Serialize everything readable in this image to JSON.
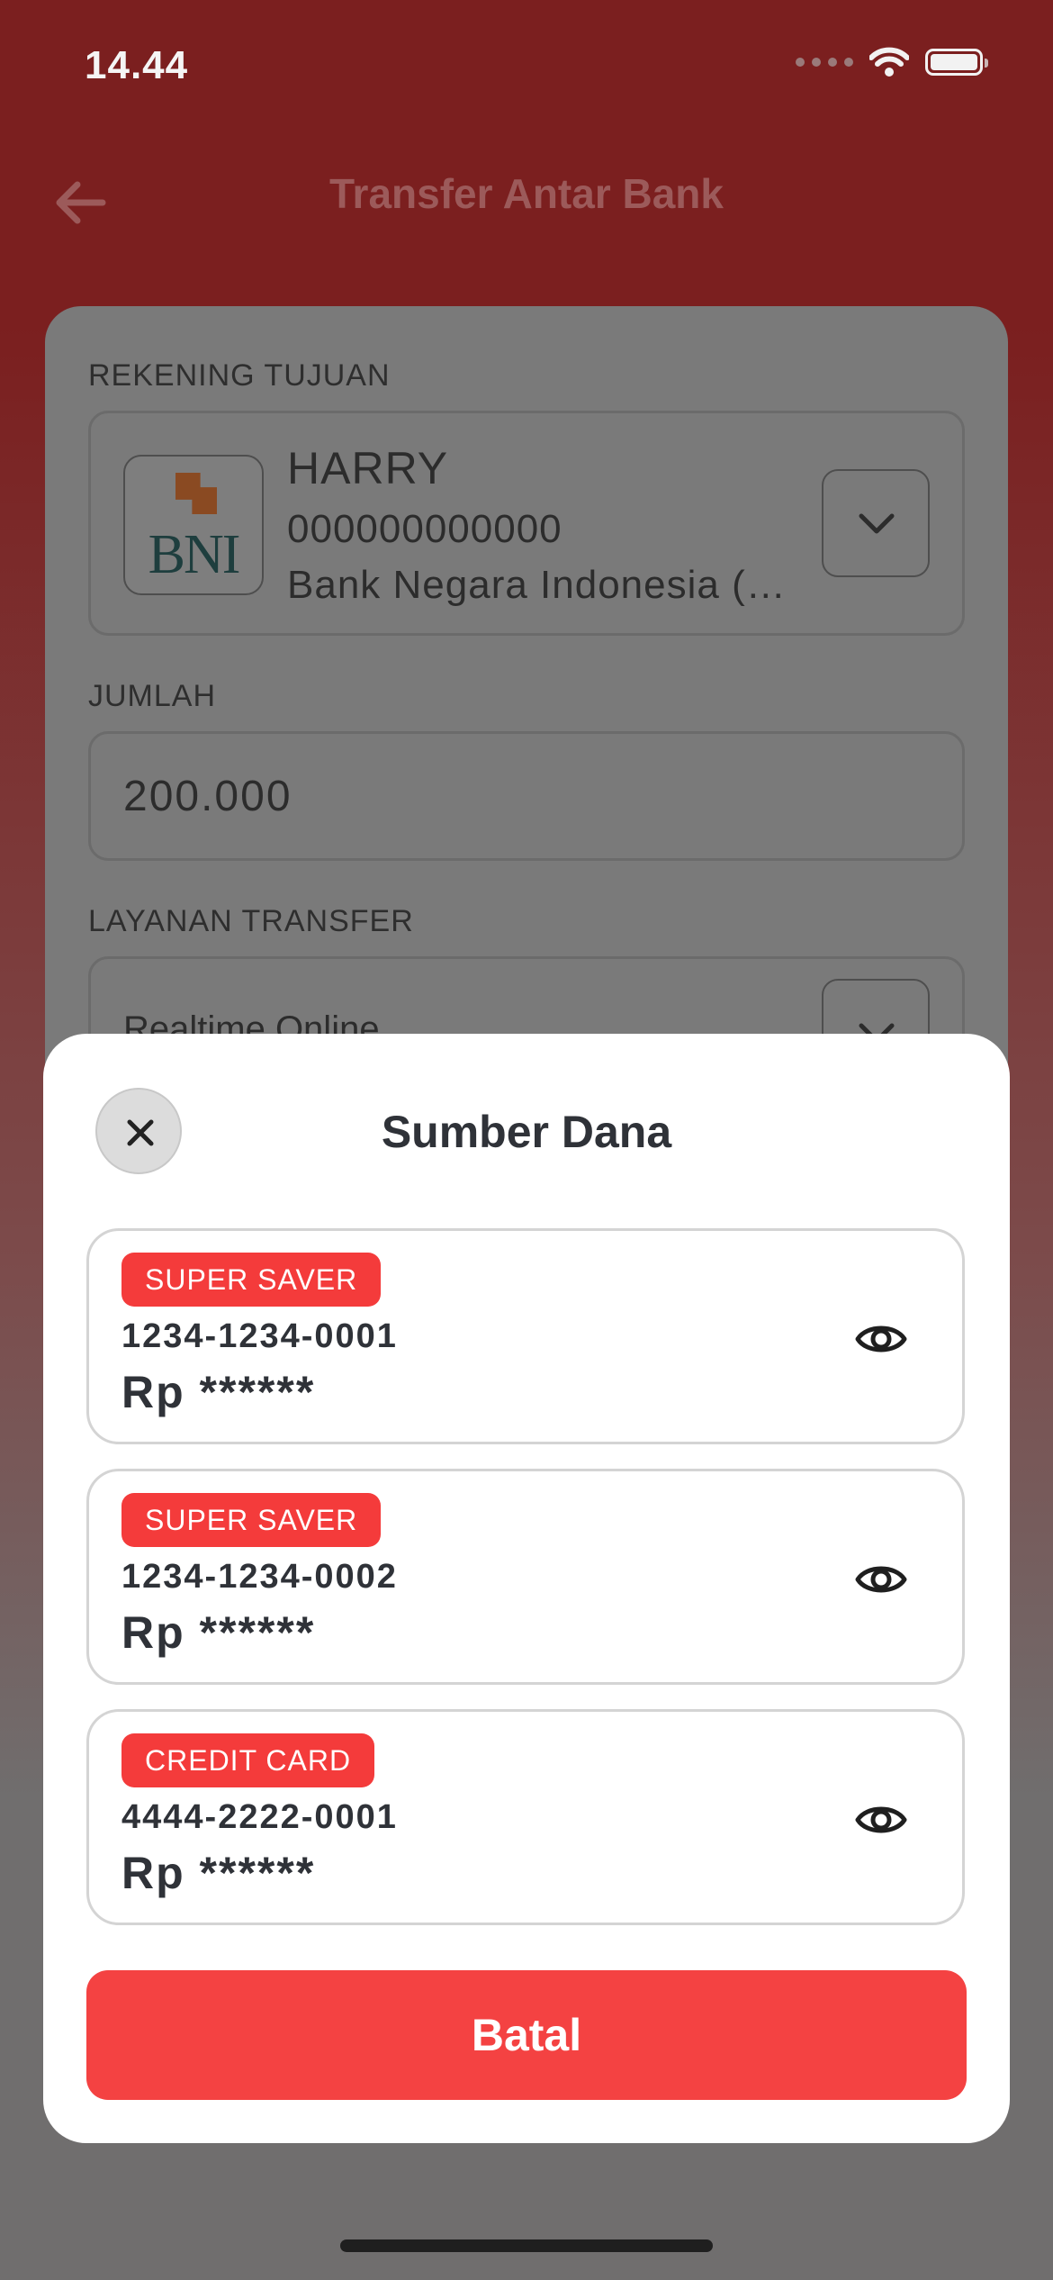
{
  "status_bar": {
    "time": "14.44"
  },
  "nav": {
    "title": "Transfer Antar Bank"
  },
  "form": {
    "recipient_label": "REKENING TUJUAN",
    "recipient": {
      "bank_logo_text": "BNI",
      "name": "HARRY",
      "account": "000000000000",
      "bank": "Bank Negara Indonesia (BNI)"
    },
    "amount_label": "JUMLAH",
    "amount": "200.000",
    "service_label": "LAYANAN TRANSFER",
    "service": "Realtime Online"
  },
  "sheet": {
    "title": "Sumber Dana",
    "accounts": [
      {
        "type": "SUPER SAVER",
        "number": "1234-1234-0001",
        "balance": "Rp ******"
      },
      {
        "type": "SUPER SAVER",
        "number": "1234-1234-0002",
        "balance": "Rp ******"
      },
      {
        "type": "CREDIT CARD",
        "number": "4444-2222-0001",
        "balance": "Rp ******"
      }
    ],
    "cancel_label": "Batal"
  },
  "icons": {
    "back": "arrow-left-icon",
    "chevron": "chevron-down-icon",
    "close": "close-icon",
    "eye": "eye-icon",
    "wifi": "wifi-icon",
    "battery": "battery-icon"
  },
  "colors": {
    "brand_red": "#f44242",
    "badge_red": "#f43b3b",
    "header_red": "#7b1f1f"
  }
}
